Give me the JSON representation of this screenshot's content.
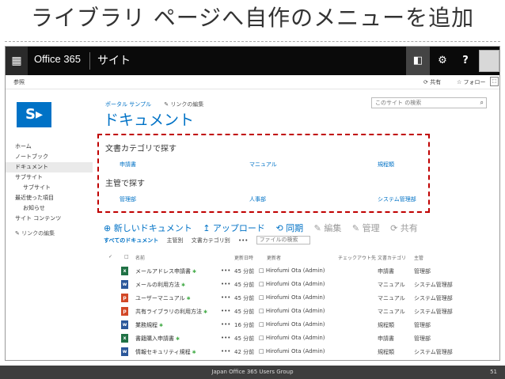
{
  "slide": {
    "title": "ライブラリ ページへ自作のメニューを追加",
    "footer_text": "Japan Office 365 Users Group",
    "page_number": "51"
  },
  "suitebar": {
    "waffle_icon": "app-launcher-icon",
    "brand": "Office 365",
    "site_label": "サイト",
    "outlook_icon": "outlook-icon",
    "settings_icon": "gear-icon",
    "help_label": "?"
  },
  "subbar": {
    "browse": "参照",
    "share": "⟳ 共有",
    "follow": "☆ フォロー",
    "focus": "⬚"
  },
  "logo": {
    "text": "S▸"
  },
  "breadcrumb": {
    "site": "ポータル サンプル",
    "edit_links": "✎ リンクの編集"
  },
  "page_title": "ドキュメント",
  "site_search": {
    "placeholder": "このサイト の検索",
    "icon": "⌕"
  },
  "leftnav": [
    "ホーム",
    "ノートブック",
    "ドキュメント",
    "サブサイト",
    "サブサイト",
    "最近使った項目",
    "お知らせ",
    "サイト コンテンツ",
    "✎ リンクの編集"
  ],
  "custom_menu": {
    "heading1": "文書カテゴリで探す",
    "links1": [
      "申請書",
      "マニュアル",
      "規程類"
    ],
    "heading2": "主管で探す",
    "links2": [
      "管理部",
      "人事部",
      "システム管理部"
    ]
  },
  "command_bar": {
    "new_doc": "⊕ 新しいドキュメント",
    "upload": "↥ アップロード",
    "sync": "⟲ 同期",
    "edit": "✎ 編集",
    "manage": "✎ 管理",
    "share": "⟳ 共有"
  },
  "views": {
    "all": "すべてのドキュメント",
    "by_owner": "主管別",
    "by_category": "文書カテゴリ別",
    "more": "•••",
    "file_search": "ファイルの検索"
  },
  "columns": {
    "check": "✓",
    "doc_icon": "□",
    "name": "名前",
    "modified": "更新日時",
    "modified_by": "更新者",
    "checked_out": "チェックアウト先",
    "category": "文書カテゴリ",
    "owner": "主管"
  },
  "rows": [
    {
      "icon": "x",
      "icon_color": "#207245",
      "name": "メールアドレス申請書",
      "new": "✱",
      "dots": "•••",
      "modified": "45 分前",
      "by": "□ Hirofumi Ota (Admin)",
      "category": "申請書",
      "owner": "管理部"
    },
    {
      "icon": "w",
      "icon_color": "#2b579a",
      "name": "メールの利用方法",
      "new": "✱",
      "dots": "•••",
      "modified": "45 分前",
      "by": "□ Hirofumi Ota (Admin)",
      "category": "マニュアル",
      "owner": "システム管理部"
    },
    {
      "icon": "p",
      "icon_color": "#d24726",
      "name": "ユーザーマニュアル",
      "new": "✱",
      "dots": "•••",
      "modified": "45 分前",
      "by": "□ Hirofumi Ota (Admin)",
      "category": "マニュアル",
      "owner": "システム管理部"
    },
    {
      "icon": "p",
      "icon_color": "#d24726",
      "name": "共有ライブラリの利用方法",
      "new": "✱",
      "dots": "•••",
      "modified": "45 分前",
      "by": "□ Hirofumi Ota (Admin)",
      "category": "マニュアル",
      "owner": "システム管理部"
    },
    {
      "icon": "w",
      "icon_color": "#2b579a",
      "name": "業務規程",
      "new": "✱",
      "dots": "•••",
      "modified": "16 分前",
      "by": "□ Hirofumi Ota (Admin)",
      "category": "規程類",
      "owner": "管理部"
    },
    {
      "icon": "x",
      "icon_color": "#207245",
      "name": "書籍購入申請書",
      "new": "✱",
      "dots": "•••",
      "modified": "45 分前",
      "by": "□ Hirofumi Ota (Admin)",
      "category": "申請書",
      "owner": "管理部"
    },
    {
      "icon": "w",
      "icon_color": "#2b579a",
      "name": "情報セキュリティ規程",
      "new": "✱",
      "dots": "•••",
      "modified": "42 分前",
      "by": "□ Hirofumi Ota (Admin)",
      "category": "規程類",
      "owner": "システム管理部"
    }
  ]
}
